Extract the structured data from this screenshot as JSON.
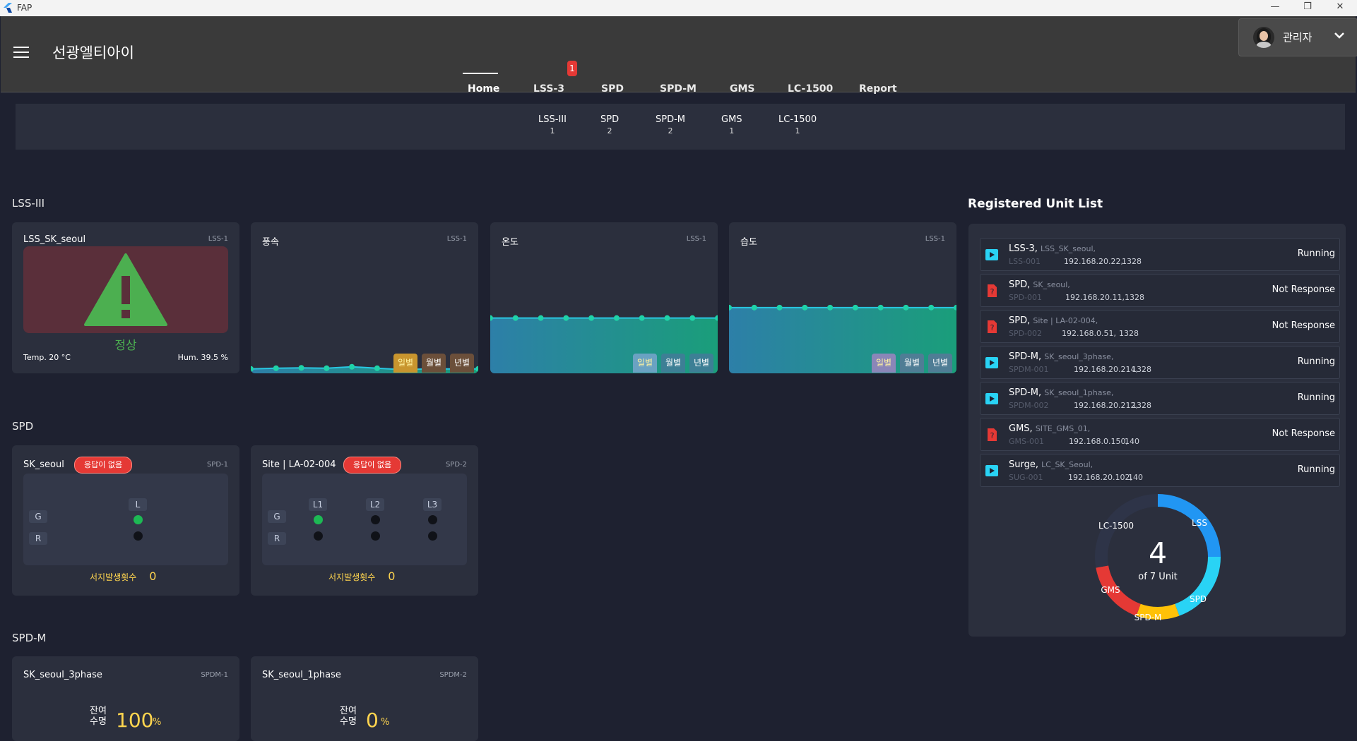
{
  "window": {
    "title": "FAP"
  },
  "header": {
    "brand": "선광엘티아이",
    "user": "관리자",
    "tabs": [
      "Home",
      "LSS-3",
      "SPD",
      "SPD-M",
      "GMS",
      "LC-1500",
      "Report"
    ],
    "active_tab": "Home",
    "lss3_badge": "1"
  },
  "summary": [
    {
      "label": "LSS-III",
      "count": "1"
    },
    {
      "label": "SPD",
      "count": "2"
    },
    {
      "label": "SPD-M",
      "count": "2"
    },
    {
      "label": "GMS",
      "count": "1"
    },
    {
      "label": "LC-1500",
      "count": "1"
    }
  ],
  "lss": {
    "section": "LSS-III",
    "status_card": {
      "name": "LSS_SK_seoul",
      "tag": "LSS-1",
      "status": "정상",
      "temp": "Temp. 20 °C",
      "hum": "Hum. 39.5 %"
    },
    "charts": [
      {
        "title": "풍속",
        "tag": "LSS-1",
        "level": 0.02
      },
      {
        "title": "온도",
        "tag": "LSS-1",
        "level": 0.36
      },
      {
        "title": "습도",
        "tag": "LSS-1",
        "level": 0.43
      }
    ],
    "period_buttons": [
      "일별",
      "월별",
      "년별"
    ]
  },
  "spd": {
    "section": "SPD",
    "surge_label": "서지발생횟수",
    "cards": [
      {
        "name": "SK_seoul",
        "tag": "SPD-1",
        "badge": "응답이 없음",
        "phases": [
          "L"
        ],
        "gr": [
          "G",
          "R"
        ],
        "surge": "0"
      },
      {
        "name": "Site | LA-02-004",
        "tag": "SPD-2",
        "badge": "응답이 없음",
        "phases": [
          "L1",
          "L2",
          "L3"
        ],
        "gr": [
          "G",
          "R"
        ],
        "surge": "0"
      }
    ]
  },
  "spdm": {
    "section": "SPD-M",
    "life_label_1": "잔여",
    "life_label_2": "수명",
    "unit": "%",
    "cards": [
      {
        "name": "SK_seoul_3phase",
        "tag": "SPDM-1",
        "life": "100"
      },
      {
        "name": "SK_seoul_1phase",
        "tag": "SPDM-2",
        "life": "0"
      }
    ]
  },
  "registered": {
    "title": "Registered Unit List",
    "rows": [
      {
        "type": "LSS-3,",
        "site": "LSS_SK_seoul,",
        "code": "LSS-001",
        "ip": "192.168.20.22,",
        "port": "1328",
        "status": "Running",
        "ok": true
      },
      {
        "type": "SPD,",
        "site": "SK_seoul,",
        "code": "SPD-001",
        "ip": "192.168.20.11,",
        "port": "1328",
        "status": "Not Response",
        "ok": false
      },
      {
        "type": "SPD,",
        "site": "Site | LA-02-004,",
        "code": "SPD-002",
        "ip": "192.168.0.51,",
        "port": "1328",
        "status": "Not Response",
        "ok": false
      },
      {
        "type": "SPD-M,",
        "site": "SK_seoul_3phase,",
        "code": "SPDM-001",
        "ip": "192.168.20.214,",
        "port": "1328",
        "status": "Running",
        "ok": true
      },
      {
        "type": "SPD-M,",
        "site": "SK_seoul_1phase,",
        "code": "SPDM-002",
        "ip": "192.168.20.212,",
        "port": "1328",
        "status": "Running",
        "ok": true
      },
      {
        "type": "GMS,",
        "site": "SITE_GMS_01,",
        "code": "GMS-001",
        "ip": "192.168.0.150,",
        "port": "140",
        "status": "Not Response",
        "ok": false
      },
      {
        "type": "Surge,",
        "site": "LC_SK_Seoul,",
        "code": "SUG-001",
        "ip": "192.168.20.102,",
        "port": "140",
        "status": "Running",
        "ok": true
      }
    ],
    "donut": {
      "center_value": "4",
      "center_label": "of 7 Unit",
      "segments": [
        {
          "name": "LSS",
          "color": "#2196f3"
        },
        {
          "name": "SPD",
          "color": "#29d3f5"
        },
        {
          "name": "SPD-M",
          "color": "#ffc107"
        },
        {
          "name": "GMS",
          "color": "#e53935"
        },
        {
          "name": "LC-1500",
          "color": "#2e3448"
        }
      ]
    }
  },
  "colors": {
    "accent": "#29d3f5",
    "warning_green": "#4caf50",
    "error": "#e53935",
    "surge_yellow": "#ffd54f"
  }
}
